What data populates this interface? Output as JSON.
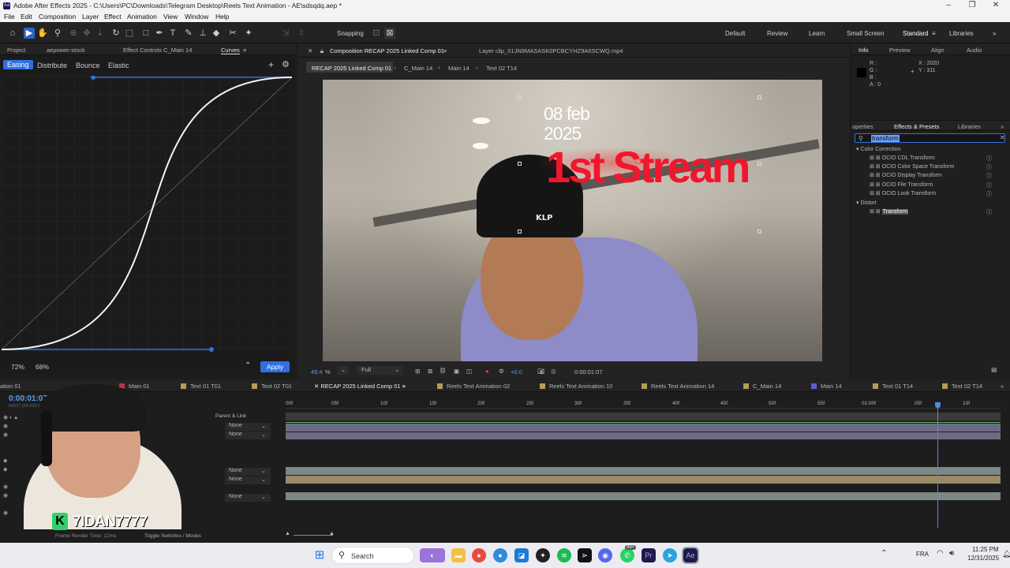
{
  "window": {
    "title": "Adobe After Effects 2025 - C:\\Users\\PC\\Downloads\\Telegram Desktop\\Reels Text Animation - AE\\sdsqdq.aep *",
    "app_badge": "Ae"
  },
  "menu": [
    "File",
    "Edit",
    "Composition",
    "Layer",
    "Effect",
    "Animation",
    "View",
    "Window",
    "Help"
  ],
  "toolbar": {
    "snapping": "Snapping",
    "workspaces": [
      "Default",
      "Review",
      "Learn",
      "Small Screen",
      "Standard",
      "Libraries"
    ]
  },
  "left_panel": {
    "tabs": [
      "Project",
      "aepower-stock",
      "Effect Controls C_Main 14",
      "Curves"
    ],
    "modes": [
      "Easing",
      "Distribute",
      "Bounce",
      "Elastic"
    ],
    "influence_in": "72%",
    "influence_out": "68%",
    "apply": "Apply"
  },
  "comp_panel": {
    "tab": "Composition RECAP 2025 Linked Comp 01",
    "layer_tab": "Layer clip_01JN9MASASK0PCBCYHZ9A6SCWQ.mp4",
    "breadcrumbs": [
      "RECAP 2025 Linked Comp 01",
      "C_Main 14",
      "Main 14",
      "Text 02 T14"
    ],
    "zoom": "49.4",
    "zoom_unit": "%",
    "resolution": "Full",
    "exposure": "+0.0",
    "timecode": "0:00:01:07"
  },
  "overlay": {
    "date_line1": "08 feb",
    "date_line2": "2025",
    "headline": "1st Stream",
    "beanie_text": "KLP"
  },
  "info_panel": {
    "tabs": [
      "Info",
      "Preview",
      "Align",
      "Audio"
    ],
    "r": "R :",
    "g": "G :",
    "b": "B :",
    "a": "A : 0",
    "x": "X : 2020",
    "y": "Y : 311"
  },
  "effects_panel": {
    "tabs": [
      "operties",
      "Effects & Presets",
      "Libraries"
    ],
    "search": "transform",
    "groups": [
      {
        "name": "Color Correction",
        "items": [
          "OCIO CDL Transform",
          "OCIO Color Space Transform",
          "OCIO Display Transform",
          "OCIO File Transform",
          "OCIO Look Transform"
        ]
      },
      {
        "name": "Distort",
        "items": [
          "Transform"
        ]
      }
    ]
  },
  "timeline": {
    "tabs": [
      "ation 01",
      "Main 01",
      "Text 01 T01",
      "Text 02 T01",
      "RECAP 2025 Linked Comp 01",
      "Reels Text Animation 02",
      "Reels Text Animation 10",
      "Reels Text Animation 14",
      "C_Main 14",
      "Main 14",
      "Text 01 T14",
      "Text 02 T14"
    ],
    "tab_colors": [
      "#888",
      "#c0304a",
      "#b89a5a",
      "#b89a5a",
      "#999",
      "#b89a5a",
      "#b89a5a",
      "#b89a5a",
      "#b89a5a",
      "#5b5bd6",
      "#b89a5a",
      "#b89a5a"
    ],
    "timecode": "0:00:01:07",
    "frames": "00037 (59.000 fps)",
    "parent_link": "Parent & Link",
    "parent_none": "None",
    "ruler": [
      "00f",
      "05f",
      "10f",
      "15f",
      "20f",
      "25f",
      "30f",
      "35f",
      "40f",
      "45f",
      "50f",
      "55f",
      "01:00f",
      "05f",
      "10f"
    ],
    "footer_left": "Frame Render Time: 12ms",
    "footer_right": "Toggle Switches / Modes"
  },
  "streamer": {
    "name": "7IDAN7777",
    "badge": "K"
  },
  "taskbar": {
    "search": "Search",
    "lang": "FRA",
    "time": "11:25 PM",
    "date": "12/31/2025",
    "badge": "99+"
  }
}
